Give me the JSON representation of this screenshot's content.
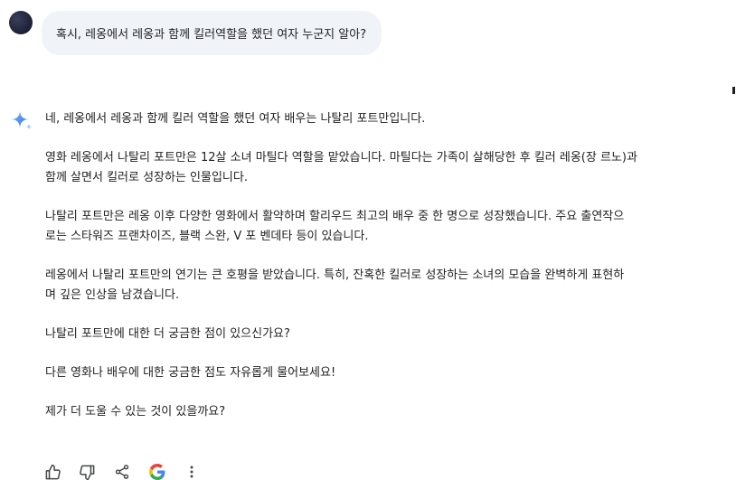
{
  "conversation": {
    "user_message": "혹시, 레옹에서 레옹과 함께 킬러역할을 했던 여자 누군지 알아?",
    "response": {
      "paragraphs": [
        {
          "lines": [
            "네, 레옹에서 레옹과 함께 킬러 역할을 했던 여자 배우는 나탈리 포트만입니다."
          ]
        },
        {
          "lines": [
            "영화 레옹에서 나탈리 포트만은 12살 소녀 마틸다 역할을 맡았습니다. 마틸다는 가족이 살해당한 후 킬러 레옹(장 르노)과",
            "함께 살면서 킬러로 성장하는 인물입니다."
          ]
        },
        {
          "lines": [
            "나탈리 포트만은 레옹 이후 다양한 영화에서 활약하며 할리우드 최고의 배우 중 한 명으로 성장했습니다. 주요 출연작으",
            "로는 스타워즈 프랜차이즈, 블랙 스완, V 포 벤데타 등이 있습니다."
          ]
        },
        {
          "lines": [
            "레옹에서 나탈리 포트만의 연기는 큰 호평을 받았습니다. 특히, 잔혹한 킬러로 성장하는 소녀의 모습을 완벽하게 표현하",
            "며 깊은 인상을 남겼습니다."
          ]
        },
        {
          "lines": [
            "나탈리 포트만에 대한 더 궁금한 점이 있으신가요?"
          ]
        },
        {
          "lines": [
            "다른 영화나 배우에 대한 궁금한 점도 자유롭게 물어보세요!"
          ]
        },
        {
          "lines": [
            "제가 더 도울 수 있는 것이 있을까요?"
          ]
        }
      ]
    }
  },
  "actions": [
    {
      "icon": "thumbs-up-icon"
    },
    {
      "icon": "thumbs-down-icon"
    },
    {
      "icon": "share-icon"
    },
    {
      "icon": "google-icon"
    },
    {
      "icon": "more-vertical-icon"
    }
  ],
  "colors": {
    "text": "#1f1f1f",
    "user_bubble": "#f0f4f9",
    "icon": "#444746"
  }
}
